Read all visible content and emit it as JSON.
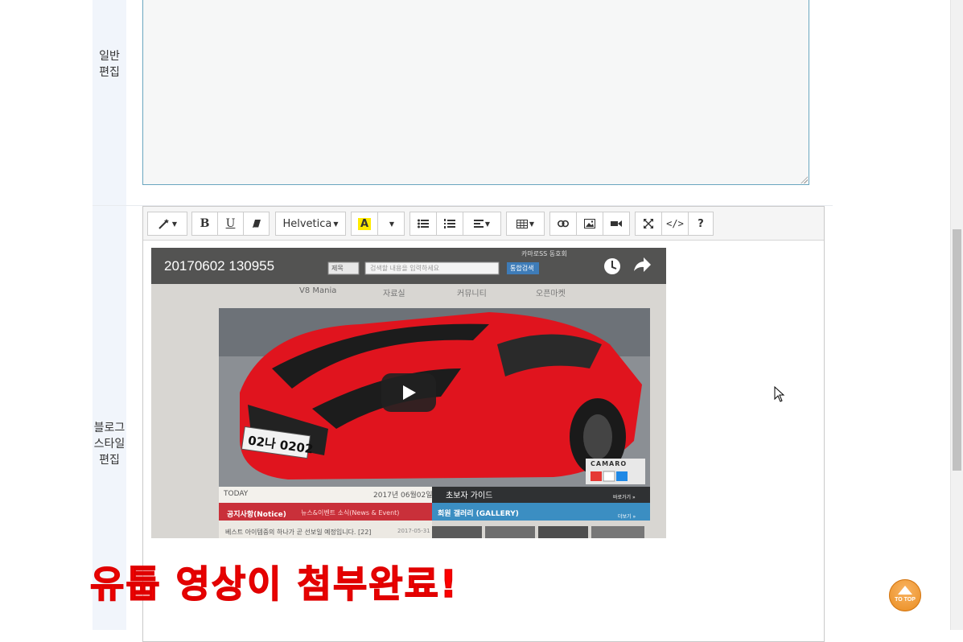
{
  "rows": [
    {
      "label_lines": [
        "일반",
        "편집"
      ]
    },
    {
      "label_lines": [
        "블로그",
        "스타일",
        "편집"
      ]
    }
  ],
  "toolbar": {
    "font_name": "Helvetica",
    "highlight_letter": "A",
    "codeview": "</>",
    "help": "?"
  },
  "video": {
    "title": "20170602 130955",
    "search_select": "제목",
    "search_placeholder": "검색할 내용을 입력하세요",
    "search_button": "통합검색",
    "top_text": "카마로SS 동호회",
    "nav": [
      "V8 Mania",
      "자료실",
      "커뮤니티",
      "오픈마켓"
    ],
    "plate": "02나 0202",
    "car_badge": "CAMARO",
    "today_label": "TODAY",
    "today_date": "2017년 06월02일",
    "guide": "초보자 가이드",
    "guide_btn": "바로가기 »",
    "notice": "공지사항(Notice)",
    "news": "뉴스&이벤트 소식(News & Event)",
    "gallery": "회원 갤러리 (GALLERY)",
    "gallery_btn": "더보기 »",
    "post": "베스트 아이템중의 하나가 곧 선보일 예정입니다. [22]",
    "post_date": "2017-05-31"
  },
  "caption": "유툽 영상이 첨부완료!",
  "totop": "TO TOP",
  "colors": {
    "caption": "#ff0000",
    "totop": "#f0a040",
    "label_bg": "#f1f5fb"
  }
}
